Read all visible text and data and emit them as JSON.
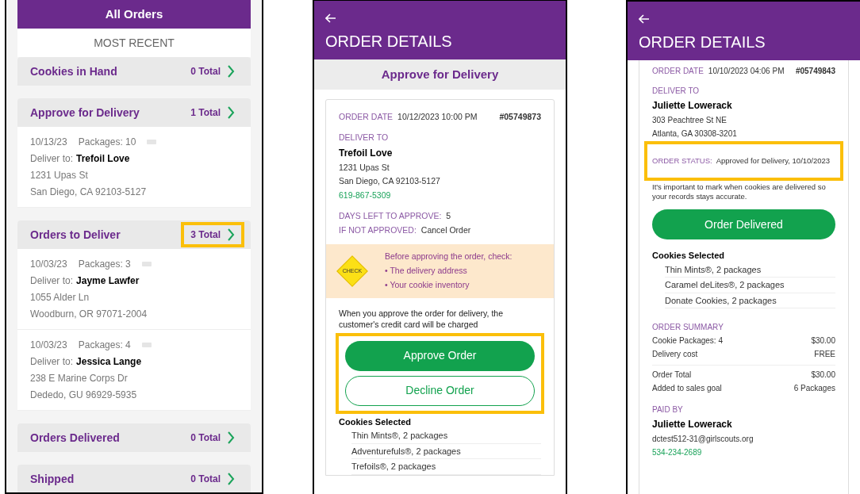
{
  "all_orders": {
    "title": "All Orders",
    "subtitle": "MOST RECENT",
    "sections": [
      {
        "title": "Cookies in Hand",
        "total": "0 Total",
        "highlighted": false
      },
      {
        "title": "Approve for Delivery",
        "total": "1 Total",
        "highlighted": false,
        "orders": [
          {
            "date": "10/13/23",
            "packages": "Packages: 10",
            "deliver_label": "Deliver to:",
            "name": "Trefoil Love",
            "street": "1231 Upas St",
            "city": "San Diego, CA 92103-5127"
          }
        ]
      },
      {
        "title": "Orders to Deliver",
        "total": "3 Total",
        "highlighted": true,
        "orders": [
          {
            "date": "10/03/23",
            "packages": "Packages: 3",
            "deliver_label": "Deliver to:",
            "name": "Jayme Lawfer",
            "street": "1055 Alder Ln",
            "city": "Woodburn, OR 97071-2004"
          },
          {
            "date": "10/03/23",
            "packages": "Packages: 4",
            "deliver_label": "Deliver to:",
            "name": "Jessica Lange",
            "street": "238 E Marine Corps Dr",
            "city": "Dededo, GU 96929-5935"
          }
        ]
      },
      {
        "title": "Orders Delivered",
        "total": "0 Total",
        "highlighted": false
      },
      {
        "title": "Shipped",
        "total": "0 Total",
        "highlighted": false
      }
    ]
  },
  "approve_details": {
    "title": "ORDER DETAILS",
    "band": "Approve for Delivery",
    "order_date_label": "ORDER DATE",
    "order_date": "10/12/2023 10:00 PM",
    "order_number": "#05749873",
    "deliver_to_label": "DELIVER TO",
    "name": "Trefoil Love",
    "street": "1231 Upas St",
    "city": "San Diego, CA 92103-5127",
    "phone": "619-867-5309",
    "facts": [
      {
        "label": "DAYS LEFT TO APPROVE:",
        "value": "5"
      },
      {
        "label": "IF NOT APPROVED:",
        "value": "Cancel Order"
      }
    ],
    "check_sign": "CHECK",
    "check_intro": "Before approving the order, check:",
    "check_items": [
      "• The delivery address",
      "• Your cookie inventory"
    ],
    "note": "When you approve the order for delivery, the customer's credit card will be charged",
    "buttons_highlighted": true,
    "buttons": [
      {
        "label": "Approve Order",
        "kind": "primary"
      },
      {
        "label": "Decline Order",
        "kind": "outline"
      }
    ],
    "cookies_title": "Cookies Selected",
    "cookies": [
      "Thin Mints®, 2 packages",
      "Adventurefuls®, 2 packages",
      "Trefoils®, 2 packages"
    ]
  },
  "delivered_details": {
    "title": "ORDER DETAILS",
    "order_date_label": "ORDER DATE",
    "order_date": "10/10/2023 04:06 PM",
    "order_number": "#05749843",
    "deliver_to_label": "DELIVER TO",
    "name": "Juliette Lowerack",
    "street": "303 Peachtree St NE",
    "city": "Atlanta, GA 30308-3201",
    "status_label": "ORDER STATUS:",
    "status": "Approved for Delivery, 10/10/2023",
    "status_highlighted": true,
    "note": "It's important to mark when cookies are delivered so your records stays accurate.",
    "button": "Order Delivered",
    "cookies_title": "Cookies Selected",
    "cookies": [
      "Thin Mints®, 2 packages",
      "Caramel deLites®, 2 packages",
      "Donate Cookies, 2 packages"
    ],
    "summary_label": "ORDER SUMMARY",
    "summary": [
      {
        "label": "Cookie Packages: 4",
        "value": "$30.00"
      },
      {
        "label": "Delivery cost",
        "value": "FREE"
      }
    ],
    "totals": [
      {
        "label": "Order Total",
        "value": "$30.00"
      },
      {
        "label": "Added to sales goal",
        "value": "6 Packages"
      }
    ],
    "paid_by_label": "PAID BY",
    "payer": "Juliette Lowerack",
    "email": "dctest512-31@girlscouts.org",
    "payer_phone": "534-234-2689"
  }
}
